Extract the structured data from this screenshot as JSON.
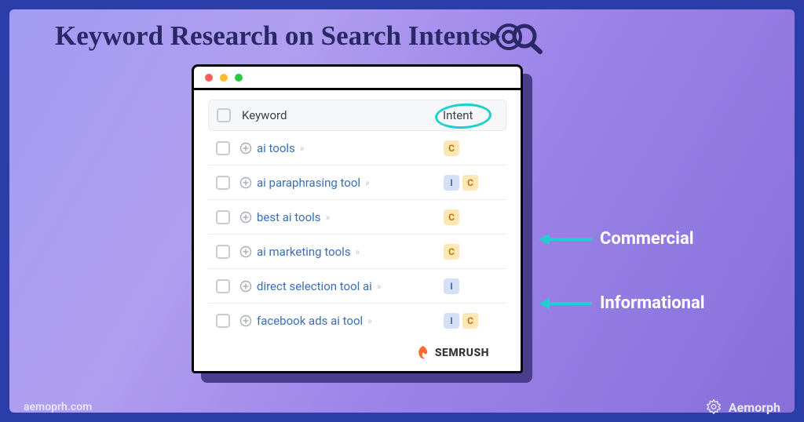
{
  "title": "Keyword Research on Search Intents",
  "table": {
    "header_keyword": "Keyword",
    "header_intent": "Intent",
    "rows": [
      {
        "keyword": "ai tools",
        "intents": [
          "C"
        ]
      },
      {
        "keyword": "ai paraphrasing tool",
        "intents": [
          "I",
          "C"
        ]
      },
      {
        "keyword": "best ai tools",
        "intents": [
          "C"
        ]
      },
      {
        "keyword": "ai marketing tools",
        "intents": [
          "C"
        ]
      },
      {
        "keyword": "direct selection tool ai",
        "intents": [
          "I"
        ]
      },
      {
        "keyword": "facebook ads ai tool",
        "intents": [
          "I",
          "C"
        ]
      }
    ]
  },
  "legend": {
    "C": "Commercial",
    "I": "Informational"
  },
  "tool_logo": "SEMRUSH",
  "footer": {
    "url": "aemoprh.com",
    "brand": "Aemorph"
  },
  "colors": {
    "accent_teal": "#1ecfd0",
    "badge_c_bg": "#fde7b6",
    "badge_c_fg": "#b47906",
    "badge_i_bg": "#d4e0f5",
    "badge_i_fg": "#4a6ca8"
  }
}
